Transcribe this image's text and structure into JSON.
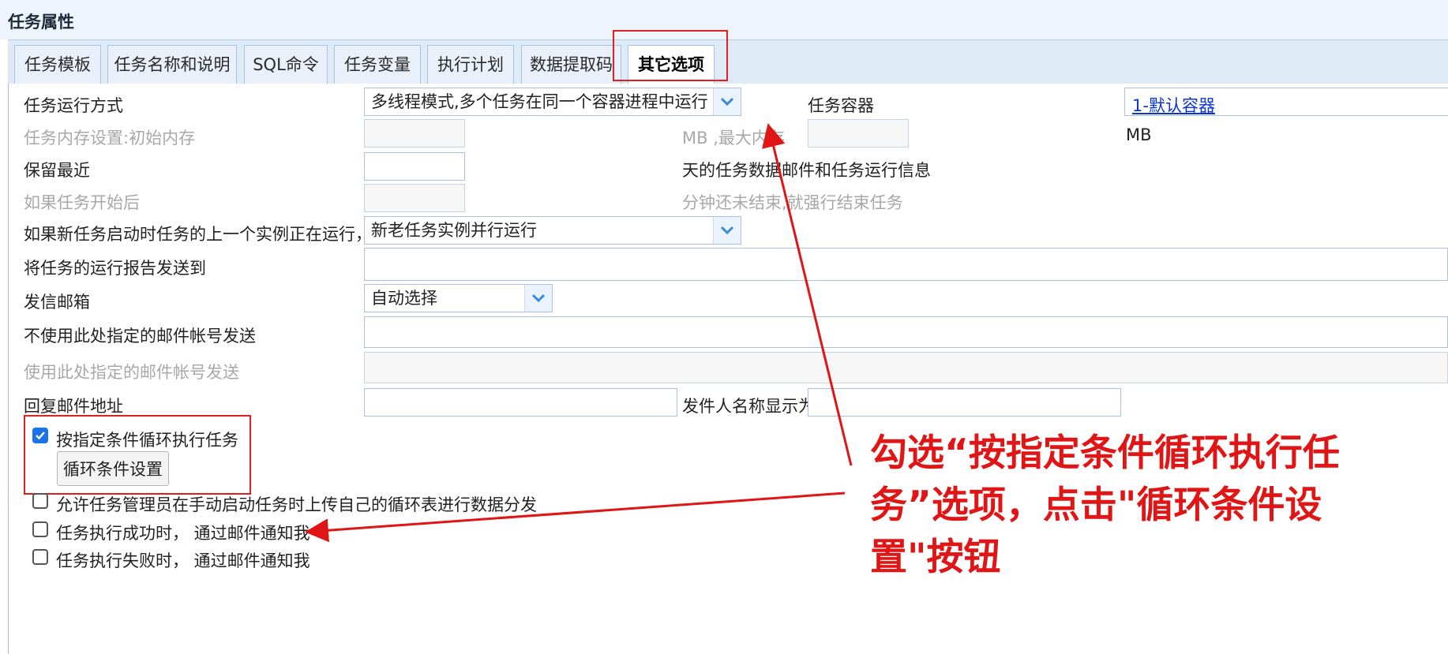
{
  "page": {
    "title": "任务属性"
  },
  "tabs": [
    {
      "label": "任务模板"
    },
    {
      "label": "任务名称和说明"
    },
    {
      "label": "SQL命令"
    },
    {
      "label": "任务变量"
    },
    {
      "label": "执行计划"
    },
    {
      "label": "数据提取码"
    },
    {
      "label": "其它选项",
      "active": true
    }
  ],
  "form": {
    "run_mode_label": "任务运行方式",
    "run_mode_value": "多线程模式,多个任务在同一个容器进程中运行",
    "container_label": "任务容器",
    "container_link": "1-默认容器",
    "memory_label": "任务内存设置:初始内存",
    "memory_max_label": "MB ,最大内存",
    "memory_unit": "MB",
    "keep_label": "保留最近",
    "keep_suffix": "天的任务数据邮件和任务运行信息",
    "timeout_label": "如果任务开始后",
    "timeout_suffix": "分钟还未结束,就强行结束任务",
    "concurrent_label": "如果新任务启动时任务的上一个实例正在运行， 则",
    "concurrent_value": "新老任务实例并行运行",
    "report_to_label": "将任务的运行报告发送到",
    "mailbox_label": "发信邮箱",
    "mailbox_value": "自动选择",
    "exclude_accounts_label": "不使用此处指定的邮件帐号发送",
    "use_accounts_label": "使用此处指定的邮件帐号发送",
    "reply_label": "回复邮件地址",
    "sender_name_label": "发件人名称显示为"
  },
  "options": {
    "loop_label": "按指定条件循环执行任务",
    "loop_checked": true,
    "loop_button": "循环条件设置",
    "allow_upload_label": "允许任务管理员在手动启动任务时上传自己的循环表进行数据分发",
    "notify_success_label": "任务执行成功时， 通过邮件通知我",
    "notify_fail_label": "任务执行失败时， 通过邮件通知我"
  },
  "annotation": {
    "callout_text": "勾选“按指定条件循环执行任务”选项，点击\"循环条件设置\"按钮",
    "color": "#e01515"
  }
}
